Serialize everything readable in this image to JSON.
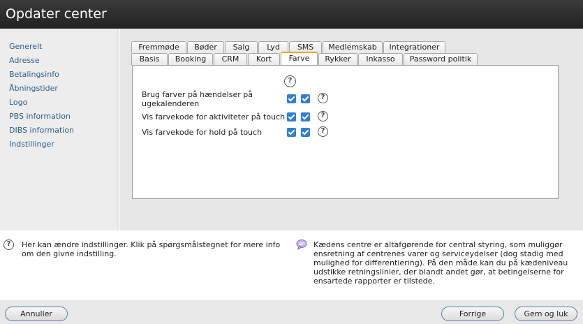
{
  "window": {
    "title": "Opdater center"
  },
  "sidebar": {
    "items": [
      {
        "label": "Generelt"
      },
      {
        "label": "Adresse"
      },
      {
        "label": "Betalingsinfo"
      },
      {
        "label": "Åbningstider"
      },
      {
        "label": "Logo"
      },
      {
        "label": "PBS information"
      },
      {
        "label": "DIBS information"
      },
      {
        "label": "Indstillinger"
      }
    ]
  },
  "tabs": {
    "row1": [
      "Fremmøde",
      "Bøder",
      "Salg",
      "Lyd",
      "SMS",
      "Medlemskab",
      "Integrationer"
    ],
    "row2": [
      "Basis",
      "Booking",
      "CRM",
      "Kort",
      "Farve",
      "Rykker",
      "Inkasso",
      "Password politik"
    ],
    "active": "Farve"
  },
  "settings": {
    "help_symbol": "?",
    "rows": [
      {
        "label": "Brug farver på hændelser på ugekalenderen",
        "checked_1": true,
        "checked_2": true
      },
      {
        "label": "Vis farvekode for aktiviteter på touch",
        "checked_1": true,
        "checked_2": true
      },
      {
        "label": "Vis farvekode for hold på touch",
        "checked_1": true,
        "checked_2": true
      }
    ]
  },
  "info": {
    "left_text": "Her kan ændre indstillinger. Klik på spørgsmålstegnet for mere info om den givne indstilling.",
    "right_text": "Kædens centre er altafgørende for central styring, som muliggør ensretning af centrenes varer og serviceydelser (dog stadig med mulighed for differentiering). På den måde kan du på kædeniveau udstikke retningslinier, der blandt andet gør, at betingelserne for ensartede rapporter er tilstede."
  },
  "buttons": {
    "cancel": "Annuller",
    "previous": "Forrige",
    "save_close": "Gem og luk"
  },
  "colors": {
    "titlebar": "#2b2b2b",
    "sidebar_link": "#2d5d88",
    "active_tab_accent": "#f0a020",
    "checkbox": "#2e7fd6"
  }
}
